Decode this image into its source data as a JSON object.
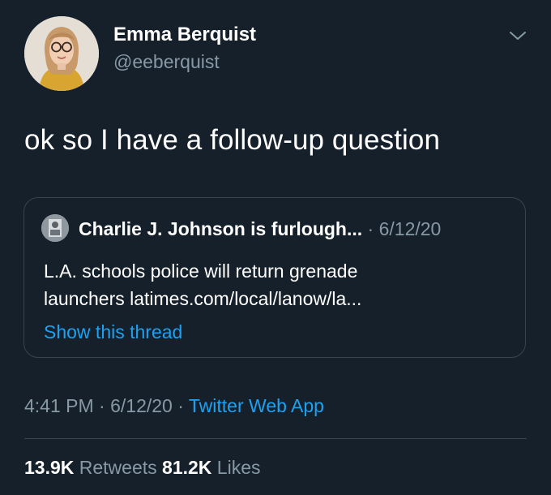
{
  "tweet": {
    "author": {
      "display_name": "Emma Berquist",
      "handle": "@eeberquist",
      "avatar_icon": "profile-photo"
    },
    "text": "ok so I have a follow-up question",
    "quoted": {
      "author_name": "Charlie J. Johnson is furlough...",
      "separator": "·",
      "date": "6/12/20",
      "text_lines": [
        "L.A. schools police will return grenade",
        "launchers latimes.com/local/lanow/la..."
      ],
      "show_thread": "Show this thread"
    },
    "meta": {
      "time": "4:41 PM",
      "sep1": "·",
      "date": "6/12/20",
      "sep2": "·",
      "source": "Twitter Web App"
    },
    "stats": {
      "retweets_count": "13.9K",
      "retweets_label": "Retweets",
      "likes_count": "81.2K",
      "likes_label": "Likes"
    },
    "caret_icon": "chevron-down-icon"
  },
  "colors": {
    "background": "#15202b",
    "text": "#ffffff",
    "secondary": "#8899a6",
    "accent": "#1da1f2",
    "border": "#38444d"
  }
}
